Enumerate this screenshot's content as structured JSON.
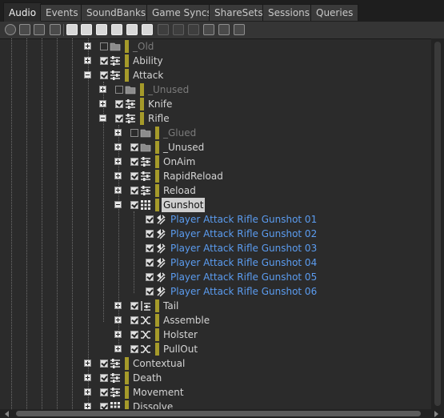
{
  "tabs": [
    {
      "label": "Audio",
      "active": true
    },
    {
      "label": "Events"
    },
    {
      "label": "SoundBanks"
    },
    {
      "label": "Game Syncs"
    },
    {
      "label": "ShareSets"
    },
    {
      "label": "Sessions"
    },
    {
      "label": "Queries"
    }
  ],
  "toolbar": {
    "buttons": [
      "power-icon",
      "folder-icon",
      "work-unit-icon",
      "actor-mixer-icon",
      "blend-container-icon",
      "sequence-container-icon",
      "random-container-icon",
      "switch-container-icon",
      "sound-sfx-icon",
      "voice-icon",
      "audio-bus-icon",
      "aux-bus-icon",
      "motion-icon",
      "layout-icon",
      "expand-icon"
    ]
  },
  "tree": [
    {
      "label": "_Old",
      "icon": "folder-icon",
      "checked": false,
      "style": "dim",
      "expand": "plus"
    },
    {
      "label": "Ability",
      "icon": "actor-mixer-icon",
      "checked": true,
      "expand": "plus"
    },
    {
      "label": "Attack",
      "icon": "actor-mixer-icon",
      "checked": true,
      "expand": "minus"
    },
    {
      "label": "_Unused",
      "icon": "folder-icon",
      "checked": false,
      "style": "dim",
      "expand": "plus"
    },
    {
      "label": "Knife",
      "icon": "actor-mixer-icon",
      "checked": true,
      "expand": "plus"
    },
    {
      "label": "Rifle",
      "icon": "actor-mixer-icon",
      "checked": true,
      "expand": "minus"
    },
    {
      "label": "_Glued",
      "icon": "folder-icon",
      "checked": false,
      "style": "dim",
      "expand": "plus"
    },
    {
      "label": "_Unused",
      "icon": "folder-icon",
      "checked": true,
      "expand": "plus"
    },
    {
      "label": "OnAim",
      "icon": "actor-mixer-icon",
      "checked": true,
      "expand": "plus"
    },
    {
      "label": "RapidReload",
      "icon": "actor-mixer-icon",
      "checked": true,
      "expand": "plus"
    },
    {
      "label": "Reload",
      "icon": "actor-mixer-icon",
      "checked": true,
      "expand": "plus"
    },
    {
      "label": "Gunshot",
      "icon": "blend-container-icon",
      "checked": true,
      "style": "selected",
      "expand": "minus"
    },
    {
      "label": "Player Attack Rifle Gunshot 01",
      "icon": "sound-sfx-icon",
      "checked": true,
      "style": "blue"
    },
    {
      "label": "Player Attack Rifle Gunshot 02",
      "icon": "sound-sfx-icon",
      "checked": true,
      "style": "blue"
    },
    {
      "label": "Player Attack Rifle Gunshot 03",
      "icon": "sound-sfx-icon",
      "checked": true,
      "style": "blue"
    },
    {
      "label": "Player Attack Rifle Gunshot 04",
      "icon": "sound-sfx-icon",
      "checked": true,
      "style": "blue"
    },
    {
      "label": "Player Attack Rifle Gunshot 05",
      "icon": "sound-sfx-icon",
      "checked": true,
      "style": "blue"
    },
    {
      "label": "Player Attack Rifle Gunshot 06",
      "icon": "sound-sfx-icon",
      "checked": true,
      "style": "blue"
    },
    {
      "label": "Tail",
      "icon": "sequence-container-icon",
      "checked": true,
      "expand": "plus"
    },
    {
      "label": "Assemble",
      "icon": "random-container-icon",
      "checked": true,
      "expand": "plus"
    },
    {
      "label": "Holster",
      "icon": "random-container-icon",
      "checked": true,
      "expand": "plus"
    },
    {
      "label": "PullOut",
      "icon": "random-container-icon",
      "checked": true,
      "expand": "plus"
    },
    {
      "label": "Contextual",
      "icon": "actor-mixer-icon",
      "checked": true,
      "expand": "plus"
    },
    {
      "label": "Death",
      "icon": "actor-mixer-icon",
      "checked": true,
      "expand": "plus"
    },
    {
      "label": "Movement",
      "icon": "actor-mixer-icon",
      "checked": true,
      "expand": "plus"
    },
    {
      "label": "Dissolve",
      "icon": "blend-container-icon",
      "checked": true,
      "expand": "plus"
    }
  ],
  "colors": {
    "work_unit_bar": "#a59a2a",
    "sound_label": "#5b9cf0",
    "selection": "#cfcfcf"
  }
}
